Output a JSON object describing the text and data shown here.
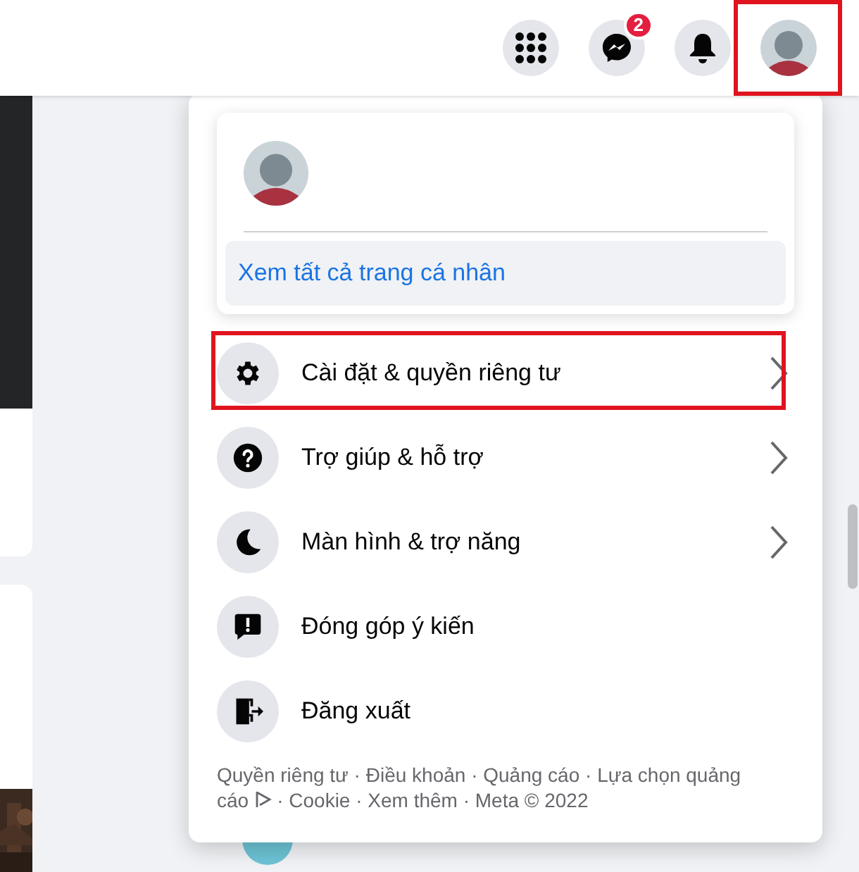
{
  "top_bar": {
    "buttons": [
      {
        "kind": "apps",
        "highlighted": false
      },
      {
        "kind": "messenger",
        "badge": "2",
        "highlighted": false
      },
      {
        "kind": "notifications",
        "highlighted": false
      },
      {
        "kind": "avatar",
        "highlighted": true
      }
    ]
  },
  "menu": {
    "profile_link": "Xem tất cả trang cá nhân",
    "items": [
      {
        "kind": "settings",
        "label": "Cài đặt & quyền riêng tư",
        "has_submenu": true,
        "highlighted": true
      },
      {
        "kind": "help",
        "label": "Trợ giúp & hỗ trợ",
        "has_submenu": true,
        "highlighted": false
      },
      {
        "kind": "display",
        "label": "Màn hình & trợ năng",
        "has_submenu": true,
        "highlighted": false
      },
      {
        "kind": "feedback",
        "label": "Đóng góp ý kiến",
        "has_submenu": false,
        "highlighted": false
      },
      {
        "kind": "logout",
        "label": "Đăng xuất",
        "has_submenu": false,
        "highlighted": false
      }
    ],
    "footer": {
      "line_1": "Quyền riêng tư · Điều khoản · Quảng cáo · Lựa chọn quảng",
      "line_2_before_icon": "cáo",
      "line_2_after_icon": "· Cookie · Xem thêm · Meta © 2022"
    }
  }
}
